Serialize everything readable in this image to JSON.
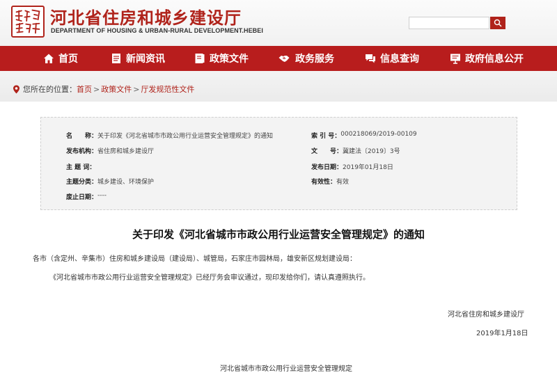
{
  "header": {
    "title": "河北省住房和城乡建设厅",
    "subtitle": "DEPARTMENT OF HOUSING & URBAN-RURAL DEVELOPMENT.HEBEI",
    "search_placeholder": ""
  },
  "nav": {
    "items": [
      {
        "label": "首页",
        "icon": "home-icon"
      },
      {
        "label": "新闻资讯",
        "icon": "document-icon"
      },
      {
        "label": "政策文件",
        "icon": "book-icon"
      },
      {
        "label": "政务服务",
        "icon": "handshake-icon"
      },
      {
        "label": "信息查询",
        "icon": "chat-icon"
      },
      {
        "label": "政府信息公开",
        "icon": "board-icon"
      }
    ]
  },
  "breadcrumb": {
    "prefix": "您所在的位置：",
    "items": [
      "首页",
      "政策文件",
      "厅发规范性文件"
    ],
    "separator": ">"
  },
  "meta": {
    "name_label": "名　　称：",
    "name_value": "关于印发《河北省城市市政公用行业运营安全管理规定》的通知",
    "index_label": "索 引 号：",
    "index_value": "000218069/2019-00109",
    "org_label": "发布机构：",
    "org_value": "省住房和城乡建设厅",
    "docno_label": "文　　号：",
    "docno_value": "冀建法〔2019〕3号",
    "subject_label": "主 题 词：",
    "subject_value": "",
    "date_label": "发布日期：",
    "date_value": "2019年01月18日",
    "category_label": "主题分类：",
    "category_value": "城乡建设、环境保护",
    "validity_label": "有效性：",
    "validity_value": "有效",
    "abolish_label": "废止日期：",
    "abolish_value": "----"
  },
  "document": {
    "title": "关于印发《河北省城市市政公用行业运营安全管理规定》的通知",
    "recipients": "各市（含定州、辛集市）住房和城乡建设局（建设局）、城管局，石家庄市园林局，雄安新区规划建设局：",
    "body": "《河北省城市市政公用行业运营安全管理规定》已经厅务会审议通过，现印发给你们，请认真遵照执行。",
    "signature": "河北省住房和城乡建设厅",
    "date": "2019年1月18日",
    "attachment_title": "河北省城市市政公用行业运营安全管理规定"
  },
  "colors": {
    "brand_red": "#b81d1d",
    "title_red": "#b0231b"
  }
}
